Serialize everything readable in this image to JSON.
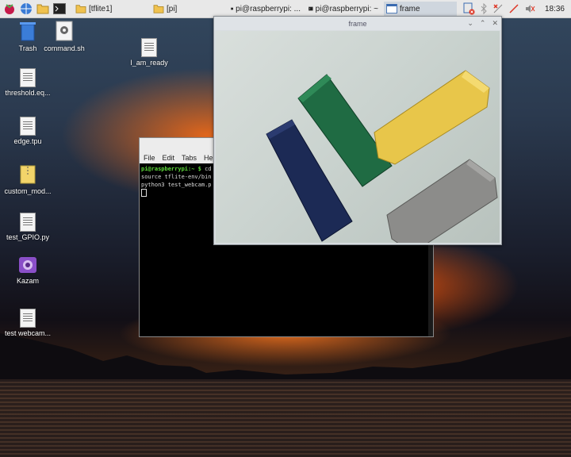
{
  "taskbar": {
    "launchers": [
      "raspberry-icon",
      "globe-icon",
      "folder-icon",
      "terminal-icon"
    ],
    "tasks": [
      {
        "label": "[tflite1]",
        "icon": "folder-icon",
        "active": false
      },
      {
        "label": "[pi]",
        "icon": "folder-icon",
        "active": false
      },
      {
        "label": "pi@raspberrypi: ...",
        "icon": "terminal-icon",
        "active": false
      },
      {
        "label": "pi@raspberrypi: ~",
        "icon": "terminal-icon",
        "active": false
      },
      {
        "label": "frame",
        "icon": "window-icon",
        "active": true
      }
    ],
    "clock": "18:36"
  },
  "desktop_icons": [
    {
      "label": "Trash"
    },
    {
      "label": "command.sh"
    },
    {
      "label": "I_am_ready"
    },
    {
      "label": "threshold.eq..."
    },
    {
      "label": "edge.tpu"
    },
    {
      "label": "custom_mod..."
    },
    {
      "label": "test_GPIO.py"
    },
    {
      "label": "Kazam"
    },
    {
      "label": "test webcam..."
    }
  ],
  "terminal": {
    "menu": [
      "File",
      "Edit",
      "Tabs",
      "Help"
    ],
    "prompt": "pi@raspberrypi:~ $",
    "lines": [
      "cd",
      "source tflite-env/bin",
      "python3 test_webcam.p"
    ]
  },
  "frame_window": {
    "title": "frame",
    "blocks": [
      "#1c2a55",
      "#1f6b43",
      "#e8c64a",
      "#8c8c8a"
    ]
  },
  "colors": {
    "taskbar": "#e8e8e8",
    "prompt": "#5ddb3a"
  }
}
